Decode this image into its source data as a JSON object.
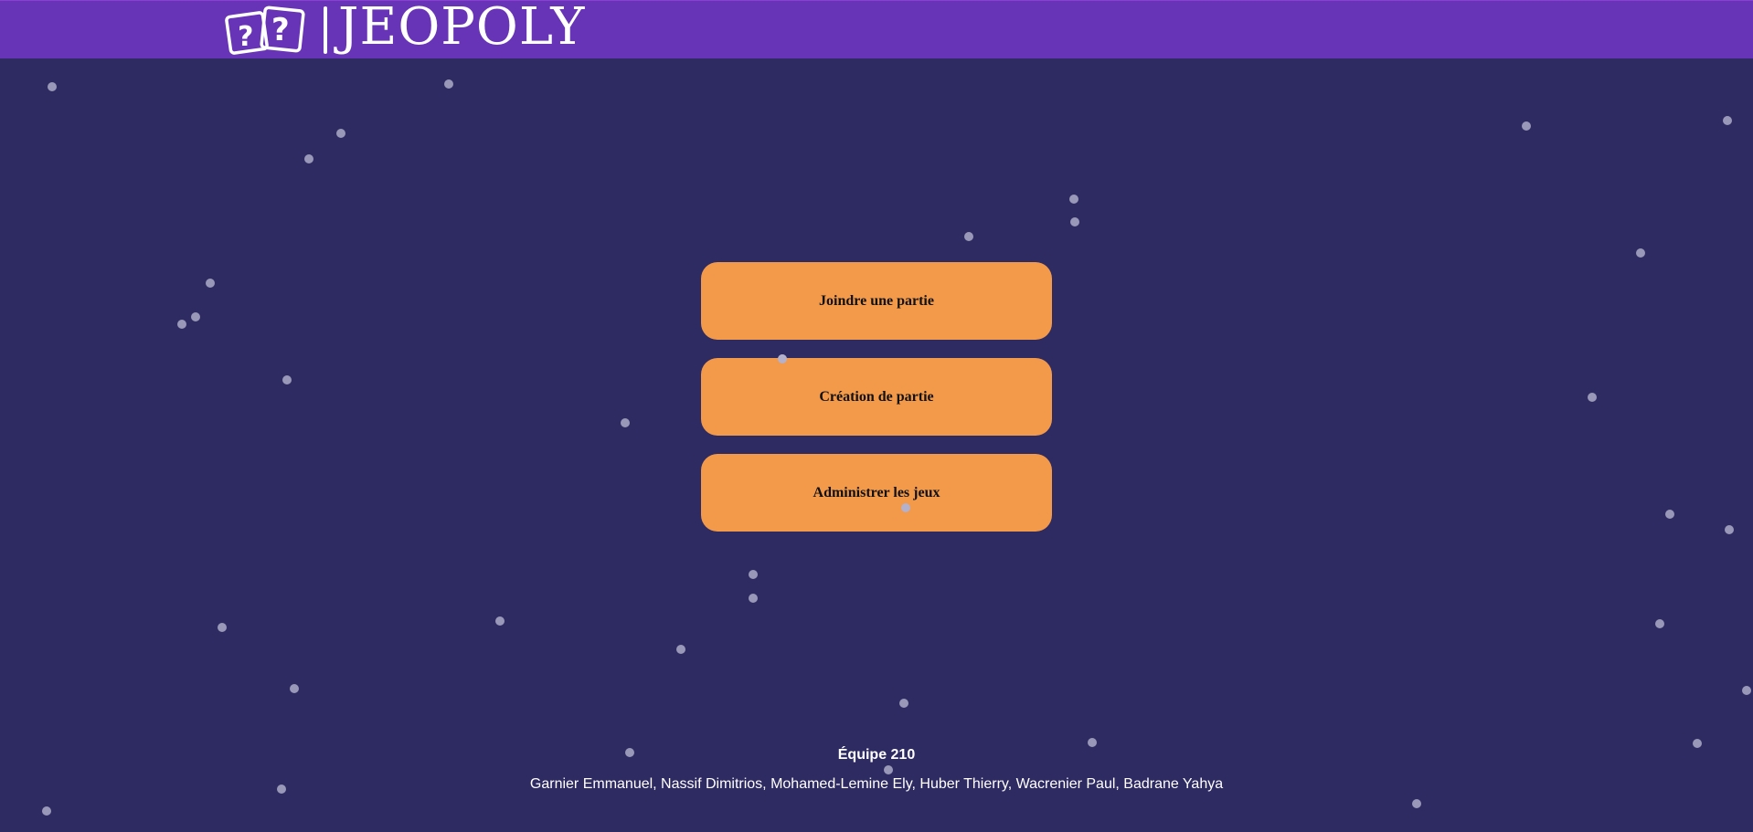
{
  "header": {
    "app_title": "JEOPOLY",
    "logo_icon": "question-dice-icon"
  },
  "menu": {
    "join_label": "Joindre une partie",
    "create_label": "Création de partie",
    "admin_label": "Administrer les jeux",
    "button_color": "#f2994a"
  },
  "footer": {
    "team": "Équipe 210",
    "members": "Garnier Emmanuel, Nassif Dimitrios, Mohamed-Lemine Ely, Huber Thierry, Wacrenier Paul, Badrane Yahya"
  },
  "colors": {
    "background": "#2e2a62",
    "header": "#6834b7",
    "star": "#9a98b8"
  }
}
